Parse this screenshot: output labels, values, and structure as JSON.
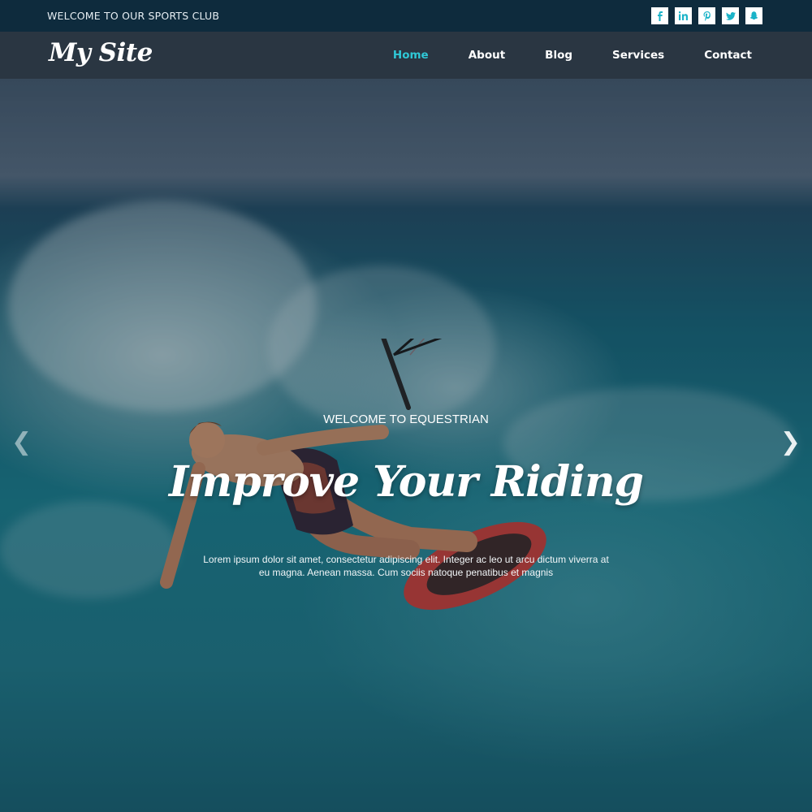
{
  "topbar": {
    "welcome_text": "WELCOME TO OUR SPORTS CLUB",
    "socials": [
      {
        "name": "facebook-icon",
        "glyph": "f"
      },
      {
        "name": "linkedin-icon",
        "glyph": "in"
      },
      {
        "name": "pinterest-icon",
        "glyph": "p"
      },
      {
        "name": "twitter-icon",
        "glyph": "t"
      },
      {
        "name": "snapchat-icon",
        "glyph": "s"
      }
    ]
  },
  "header": {
    "logo": "My Site",
    "nav": [
      {
        "label": "Home",
        "active": true
      },
      {
        "label": "About",
        "active": false
      },
      {
        "label": "Blog",
        "active": false
      },
      {
        "label": "Services",
        "active": false
      },
      {
        "label": "Contact",
        "active": false
      }
    ]
  },
  "hero": {
    "subtitle": "WELCOME TO EQUESTRIAN",
    "title": "Improve Your Riding",
    "text_line1": "Lorem ipsum dolor sit amet, consectetur adipiscing elit. Integer ac leo ut arcu dictum viverra at",
    "text_line2": "eu magna. Aenean massa. Cum sociis natoque penatibus et magnis",
    "prev_arrow": "❮",
    "next_arrow": "❯"
  },
  "colors": {
    "topbar_bg": "#0e2b3d",
    "header_bg": "#2a3642",
    "accent": "#2fc8d6",
    "board": "#d0443f"
  }
}
